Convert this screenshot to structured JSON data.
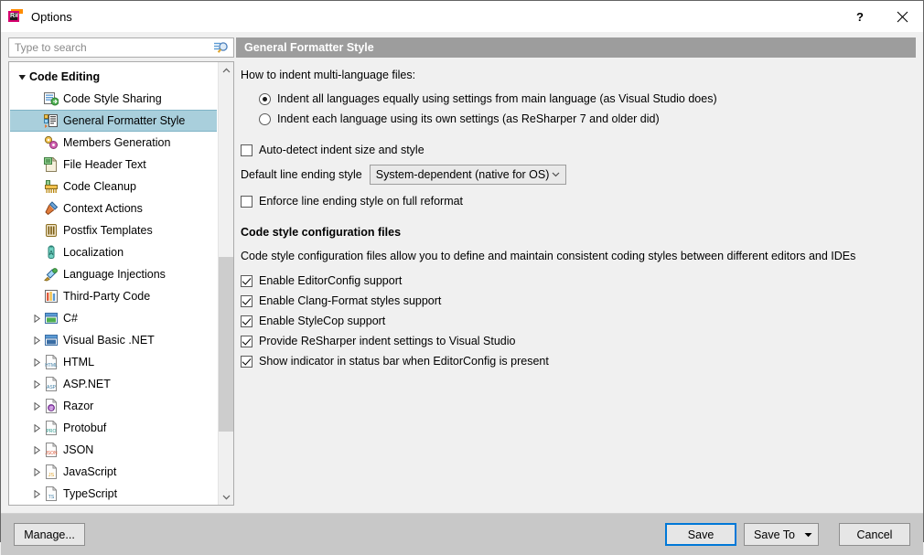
{
  "window": {
    "title": "Options",
    "icon": "resharper-logo-icon",
    "icon_label": "R#",
    "help_button": "?",
    "close_button": "✕"
  },
  "search": {
    "placeholder": "Type to search",
    "value": "",
    "icon": "search-icon"
  },
  "tree": {
    "items": [
      {
        "label": "Code Editing",
        "level": 0,
        "twisty": "expanded",
        "icon": "none",
        "bold": true,
        "selected": false
      },
      {
        "label": "Code Style Sharing",
        "level": 1,
        "twisty": "none",
        "icon": "code-style-sharing",
        "bold": false,
        "selected": false
      },
      {
        "label": "General Formatter Style",
        "level": 1,
        "twisty": "none",
        "icon": "formatter-style",
        "bold": false,
        "selected": true
      },
      {
        "label": "Members Generation",
        "level": 1,
        "twisty": "none",
        "icon": "members-generation",
        "bold": false,
        "selected": false
      },
      {
        "label": "File Header Text",
        "level": 1,
        "twisty": "none",
        "icon": "file-header-text",
        "bold": false,
        "selected": false
      },
      {
        "label": "Code Cleanup",
        "level": 1,
        "twisty": "none",
        "icon": "code-cleanup",
        "bold": false,
        "selected": false
      },
      {
        "label": "Context Actions",
        "level": 1,
        "twisty": "none",
        "icon": "context-actions",
        "bold": false,
        "selected": false
      },
      {
        "label": "Postfix Templates",
        "level": 1,
        "twisty": "none",
        "icon": "postfix-templates",
        "bold": false,
        "selected": false
      },
      {
        "label": "Localization",
        "level": 1,
        "twisty": "none",
        "icon": "localization",
        "bold": false,
        "selected": false
      },
      {
        "label": "Language Injections",
        "level": 1,
        "twisty": "none",
        "icon": "language-injections",
        "bold": false,
        "selected": false
      },
      {
        "label": "Third-Party Code",
        "level": 1,
        "twisty": "none",
        "icon": "third-party-code",
        "bold": false,
        "selected": false
      },
      {
        "label": "C#",
        "level": 1,
        "twisty": "collapsed",
        "icon": "csharp",
        "bold": false,
        "selected": false
      },
      {
        "label": "Visual Basic .NET",
        "level": 1,
        "twisty": "collapsed",
        "icon": "vbnet",
        "bold": false,
        "selected": false
      },
      {
        "label": "HTML",
        "level": 1,
        "twisty": "collapsed",
        "icon": "html",
        "bold": false,
        "selected": false
      },
      {
        "label": "ASP.NET",
        "level": 1,
        "twisty": "collapsed",
        "icon": "aspnet",
        "bold": false,
        "selected": false
      },
      {
        "label": "Razor",
        "level": 1,
        "twisty": "collapsed",
        "icon": "razor",
        "bold": false,
        "selected": false
      },
      {
        "label": "Protobuf",
        "level": 1,
        "twisty": "collapsed",
        "icon": "protobuf",
        "bold": false,
        "selected": false
      },
      {
        "label": "JSON",
        "level": 1,
        "twisty": "collapsed",
        "icon": "json",
        "bold": false,
        "selected": false
      },
      {
        "label": "JavaScript",
        "level": 1,
        "twisty": "collapsed",
        "icon": "javascript",
        "bold": false,
        "selected": false
      },
      {
        "label": "TypeScript",
        "level": 1,
        "twisty": "collapsed",
        "icon": "typescript",
        "bold": false,
        "selected": false
      }
    ]
  },
  "panel": {
    "header": "General Formatter Style",
    "indent_question": "How to indent multi-language files:",
    "radios": [
      {
        "label": "Indent all languages equally using settings from main language (as Visual Studio does)",
        "checked": true
      },
      {
        "label": "Indent each language using its own settings (as ReSharper 7 and older did)",
        "checked": false
      }
    ],
    "autodetect": {
      "label": "Auto-detect indent size and style",
      "checked": false
    },
    "line_ending": {
      "label": "Default line ending style",
      "value": "System-dependent (native for OS)",
      "arrow_icon": "chevron-down-icon"
    },
    "enforce": {
      "label": "Enforce line ending style on full reformat",
      "checked": false
    },
    "config_section": {
      "heading": "Code style configuration files",
      "description": "Code style configuration files allow you to define and maintain consistent coding styles between different editors and IDEs",
      "checkboxes": [
        {
          "label": "Enable EditorConfig support",
          "checked": true
        },
        {
          "label": "Enable Clang-Format styles support",
          "checked": true
        },
        {
          "label": "Enable StyleCop support",
          "checked": true
        },
        {
          "label": "Provide ReSharper indent settings to Visual Studio",
          "checked": true
        },
        {
          "label": "Show indicator in status bar when EditorConfig is present",
          "checked": true
        }
      ]
    }
  },
  "footer": {
    "manage": "Manage...",
    "save": "Save",
    "save_to": "Save To",
    "save_to_arrow": "▾",
    "cancel": "Cancel",
    "focus_color": "#0078d7"
  }
}
